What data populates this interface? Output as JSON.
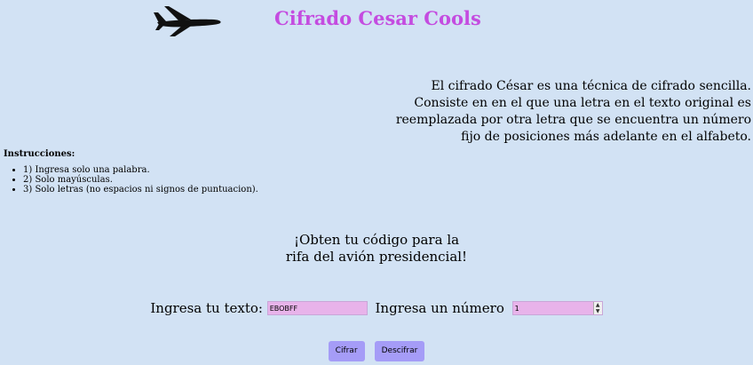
{
  "header": {
    "title": "Cifrado Cesar Cools",
    "logo_icon": "airplane-icon"
  },
  "description": "El cifrado César es una técnica de cifrado sencilla. Consiste en en el que una letra en el texto original es reemplazada por otra letra que se encuentra un número fijo de posiciones más adelante en el alfabeto.",
  "instructions": {
    "title": "Instrucciones:",
    "items": [
      "1) Ingresa solo una palabra.",
      "2) Solo mayúsculas.",
      "3) Solo letras (no espacios ni signos de puntuacion)."
    ]
  },
  "prize": {
    "line1": "¡Obten tu código para la",
    "line2": "rifa del avión presidencial!"
  },
  "form": {
    "text_label": "Ingresa tu texto:",
    "text_value": "EBOBFF",
    "number_label": "Ingresa un número",
    "number_value": "1",
    "spinner_icon": "spinner-arrows-icon"
  },
  "buttons": {
    "encrypt": "Cifrar",
    "decrypt": "Descifrar"
  },
  "colors": {
    "background": "#d2e2f4",
    "title": "#c44ce0",
    "input_background": "#e8b3ea",
    "button_background": "#a59cf7"
  }
}
